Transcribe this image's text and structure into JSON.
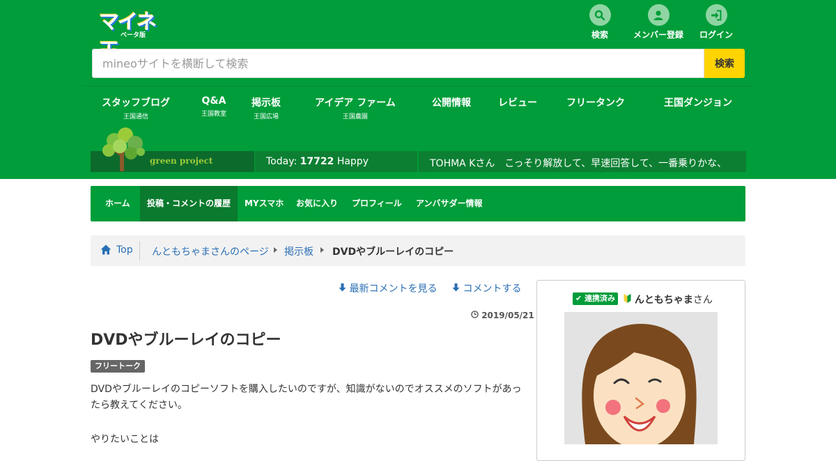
{
  "brand": {
    "logo_text": "マイネ王",
    "logo_sub": "ベータ版",
    "colors": {
      "primary": "#009d3a",
      "accent": "#ffd400",
      "link": "#2a6fb5"
    }
  },
  "header_actions": [
    {
      "label": "検索",
      "icon": "search-icon"
    },
    {
      "label": "メンバー登録",
      "icon": "user-icon"
    },
    {
      "label": "ログイン",
      "icon": "login-icon"
    }
  ],
  "search": {
    "placeholder": "mineoサイトを横断して検索",
    "value": "",
    "button_label": "検索"
  },
  "main_nav": [
    {
      "label": "スタッフブログ",
      "sub": "王国通信"
    },
    {
      "label": "Q&A",
      "sub": "王国教室"
    },
    {
      "label": "掲示板",
      "sub": "王国広場"
    },
    {
      "label": "アイデア ファーム",
      "sub": "王国農園"
    },
    {
      "label": "公開情報",
      "sub": ""
    },
    {
      "label": "レビュー",
      "sub": ""
    },
    {
      "label": "フリータンク",
      "sub": ""
    },
    {
      "label": "王国ダンジョン",
      "sub": ""
    }
  ],
  "green_project": {
    "label": "green project",
    "today_label": "Today:",
    "today_count": "17722",
    "today_suffix": "Happy",
    "ticker": "TOHMA Kさん　こっそり解放して、早速回答して、一番乗りかな、"
  },
  "sub_nav": [
    {
      "label": "ホーム",
      "active": false
    },
    {
      "label": "投稿・コメントの履歴",
      "active": true
    },
    {
      "label": "MYスマホ",
      "active": false
    },
    {
      "label": "お気に入り",
      "active": false
    },
    {
      "label": "プロフィール",
      "active": false
    },
    {
      "label": "アンバサダー情報",
      "active": false
    }
  ],
  "breadcrumb": {
    "home": "Top",
    "items": [
      "んともちゃまさんのページ",
      "掲示板",
      "DVDやブルーレイのコピー"
    ]
  },
  "post_actions": {
    "latest_comment": "最新コメントを見る",
    "comment": "コメントする"
  },
  "post": {
    "date": "2019/05/21",
    "title": "DVDやブルーレイのコピー",
    "tag": "フリートーク",
    "body": "DVDやブルーレイのコピーソフトを購入したいのですが、知識がないのでオススメのソフトがあったら教えてください。",
    "body_cont": "やりたいことは"
  },
  "profile": {
    "badge": "連携済み",
    "name": "んともちゃま",
    "suffix": "さん"
  }
}
